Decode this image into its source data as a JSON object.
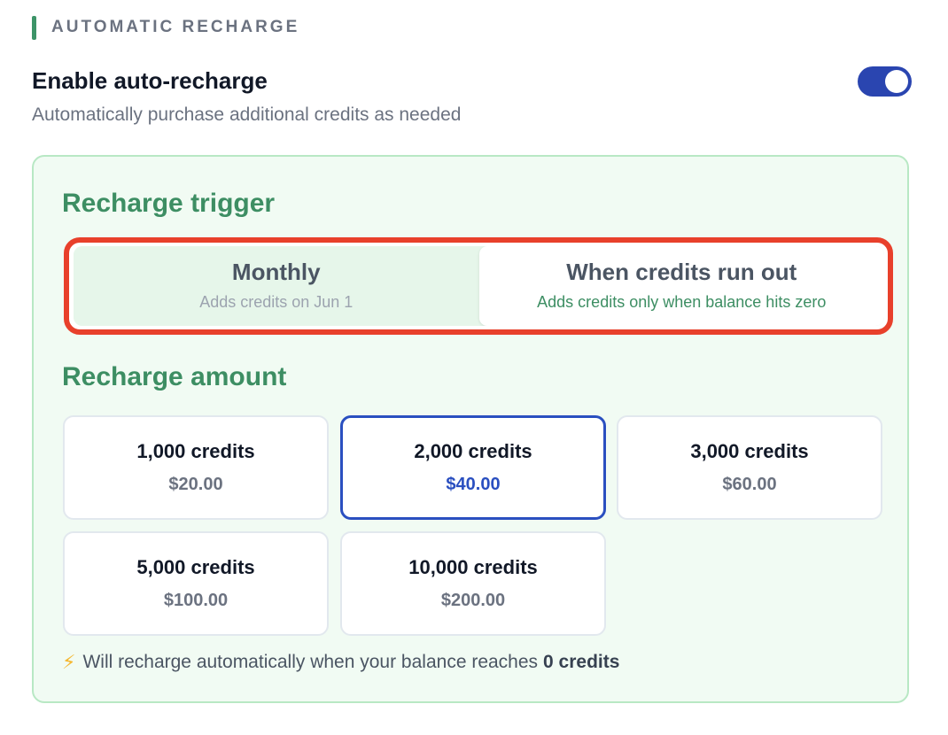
{
  "section": {
    "title": "AUTOMATIC RECHARGE"
  },
  "enable": {
    "title": "Enable auto-recharge",
    "description": "Automatically purchase additional credits as needed",
    "toggle_on": true
  },
  "trigger": {
    "heading": "Recharge trigger",
    "options": [
      {
        "label": "Monthly",
        "sub": "Adds credits on Jun 1",
        "selected": false
      },
      {
        "label": "When credits run out",
        "sub": "Adds credits only when balance hits zero",
        "selected": true
      }
    ]
  },
  "amount": {
    "heading": "Recharge amount",
    "options": [
      {
        "credits": "1,000 credits",
        "price": "$20.00",
        "selected": false
      },
      {
        "credits": "2,000 credits",
        "price": "$40.00",
        "selected": true
      },
      {
        "credits": "3,000 credits",
        "price": "$60.00",
        "selected": false
      },
      {
        "credits": "5,000 credits",
        "price": "$100.00",
        "selected": false
      },
      {
        "credits": "10,000 credits",
        "price": "$200.00",
        "selected": false
      }
    ]
  },
  "note": {
    "icon": "lightning-icon",
    "text": "Will recharge automatically when your balance reaches",
    "bold": "0 credits"
  },
  "colors": {
    "accent_green": "#3d8e63",
    "toggle_blue": "#2a45b0",
    "selected_blue": "#2a4fc0",
    "highlight_red": "#e8402b"
  }
}
